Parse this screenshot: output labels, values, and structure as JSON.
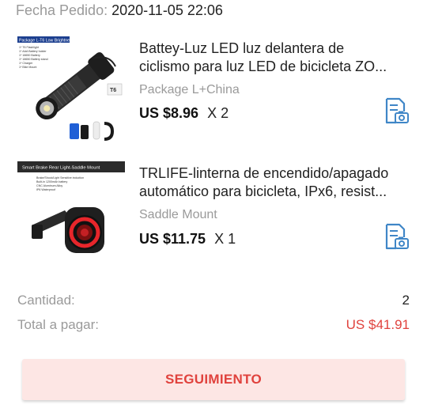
{
  "order": {
    "date_label": "Fecha Pedido:",
    "date_value": "2020-11-05 22:06"
  },
  "items": [
    {
      "title_line1": "Battey-Luz LED luz delantera de",
      "title_line2": "ciclismo para luz LED de bicicleta ZO...",
      "variant": "Package L+China",
      "price": "US $8.96",
      "quantity": "X 2",
      "thumb_text": {
        "header": "Package L-T6 Low Brightness",
        "list": [
          "1* T6 Flashlight",
          "1* AAA Battery holder",
          "1* 18650 Battery",
          "1* 18650 Battery stand",
          "1* Charger",
          "1* Bike Mount"
        ],
        "badge": "T6"
      },
      "icon": "order-snapshot-icon"
    },
    {
      "title_line1": "TRLIFE-linterna de encendido/apagado",
      "title_line2": "automático para bicicleta, IPx6, resist...",
      "variant": "Saddle Mount",
      "price": "US $11.75",
      "quantity": "X 1",
      "thumb_text": {
        "header": "Smart Brake Rear Light-Saddle Mount",
        "list": [
          "Brake/Shock/Light Sensitive induction",
          "Built-in 1200mAh battery",
          "CNC Aluminum Alloy",
          "IP6 Waterproof"
        ]
      },
      "icon": "order-snapshot-icon"
    }
  ],
  "summary": {
    "quantity_label": "Cantidad:",
    "quantity_value": "2",
    "total_label": "Total a pagar:",
    "total_value": "US $41.91"
  },
  "actions": {
    "track_label": "SEGUIMIENTO"
  },
  "colors": {
    "accent": "#e0423d",
    "button_bg": "#fde6e4",
    "icon_blue": "#3f86c7",
    "muted_text": "#9a9a9a"
  }
}
